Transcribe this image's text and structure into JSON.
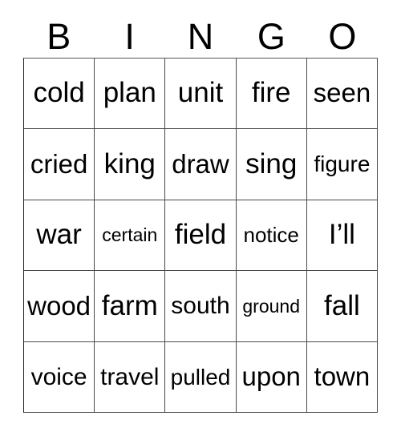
{
  "card": {
    "title": "BINGO",
    "headers": [
      "B",
      "I",
      "N",
      "G",
      "O"
    ],
    "grid_rows": [
      [
        {
          "text": "cold",
          "size": "fs-xl"
        },
        {
          "text": "plan",
          "size": "fs-xl"
        },
        {
          "text": "unit",
          "size": "fs-xl"
        },
        {
          "text": "fire",
          "size": "fs-xl"
        },
        {
          "text": "seen",
          "size": "fs-lg"
        }
      ],
      [
        {
          "text": "cried",
          "size": "fs-lg"
        },
        {
          "text": "king",
          "size": "fs-xl"
        },
        {
          "text": "draw",
          "size": "fs-lg"
        },
        {
          "text": "sing",
          "size": "fs-xl"
        },
        {
          "text": "figure",
          "size": "fs-sm"
        }
      ],
      [
        {
          "text": "war",
          "size": "fs-xl"
        },
        {
          "text": "certain",
          "size": "fs-xxs"
        },
        {
          "text": "field",
          "size": "fs-xl"
        },
        {
          "text": "notice",
          "size": "fs-xs"
        },
        {
          "text": "I’ll",
          "size": "fs-xl"
        }
      ],
      [
        {
          "text": "wood",
          "size": "fs-lg"
        },
        {
          "text": "farm",
          "size": "fs-xl"
        },
        {
          "text": "south",
          "size": "fs-md"
        },
        {
          "text": "ground",
          "size": "fs-xxs"
        },
        {
          "text": "fall",
          "size": "fs-xl"
        }
      ],
      [
        {
          "text": "voice",
          "size": "fs-md"
        },
        {
          "text": "travel",
          "size": "fs-md"
        },
        {
          "text": "pulled",
          "size": "fs-sm"
        },
        {
          "text": "upon",
          "size": "fs-lg"
        },
        {
          "text": "town",
          "size": "fs-lg"
        }
      ]
    ],
    "colors": {
      "background": "#ffffff",
      "text": "#000000",
      "grid_line": "#4a4a4a"
    }
  }
}
